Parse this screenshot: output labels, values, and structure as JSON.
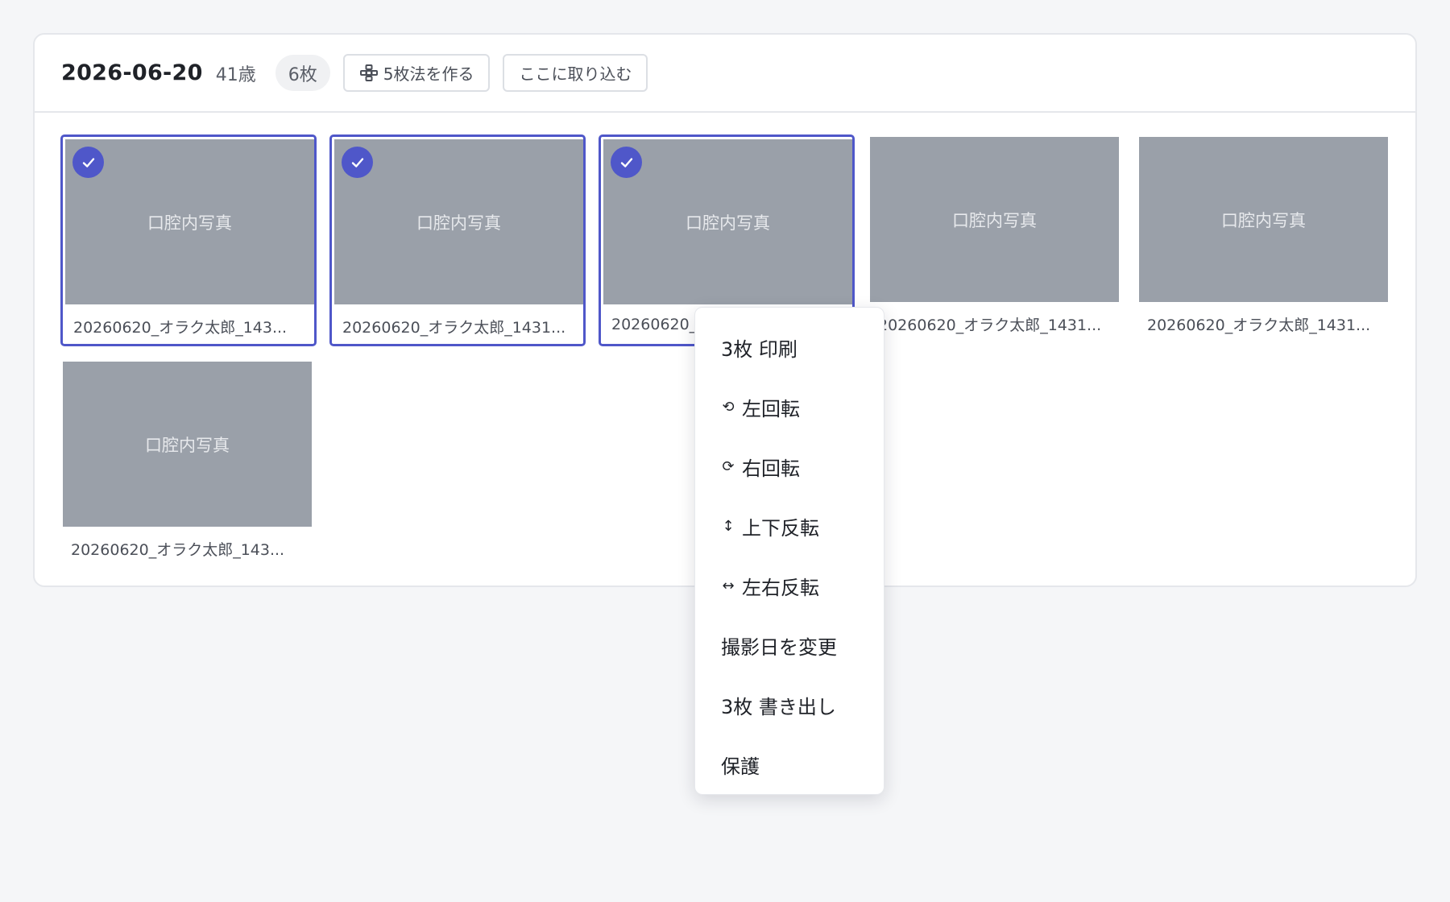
{
  "group": {
    "date": "2026-06-20",
    "age": "41歳",
    "count": "6枚",
    "make_five_button": "5枚法を作る",
    "import_button": "ここに取り込む"
  },
  "photos": [
    {
      "placeholder": "口腔内写真",
      "filename": "20260620_オラク太郎_143...",
      "selected": true
    },
    {
      "placeholder": "口腔内写真",
      "filename": "20260620_オラク太郎_1431...",
      "selected": true
    },
    {
      "placeholder": "口腔内写真",
      "filename": "20260620_",
      "selected": true
    },
    {
      "placeholder": "口腔内写真",
      "filename": "20260620_オラク太郎_1431...",
      "selected": false
    },
    {
      "placeholder": "口腔内写真",
      "filename": "20260620_オラク太郎_1431...",
      "selected": false
    },
    {
      "placeholder": "口腔内写真",
      "filename": "20260620_オラク太郎_143...",
      "selected": false
    }
  ],
  "context_menu": {
    "items": [
      {
        "label": "3枚 印刷",
        "icon": ""
      },
      {
        "label": "左回転",
        "icon": "⟲"
      },
      {
        "label": "右回転",
        "icon": "⟳"
      },
      {
        "label": "上下反転",
        "icon": "↕"
      },
      {
        "label": "左右反転",
        "icon": "↔"
      },
      {
        "label": "撮影日を変更",
        "icon": ""
      },
      {
        "label": "3枚 書き出し",
        "icon": ""
      },
      {
        "label": "保護",
        "icon": ""
      }
    ]
  },
  "colors": {
    "accent": "#4f57c9",
    "photo_placeholder": "#9aa0a9",
    "background": "#f5f6f8"
  }
}
